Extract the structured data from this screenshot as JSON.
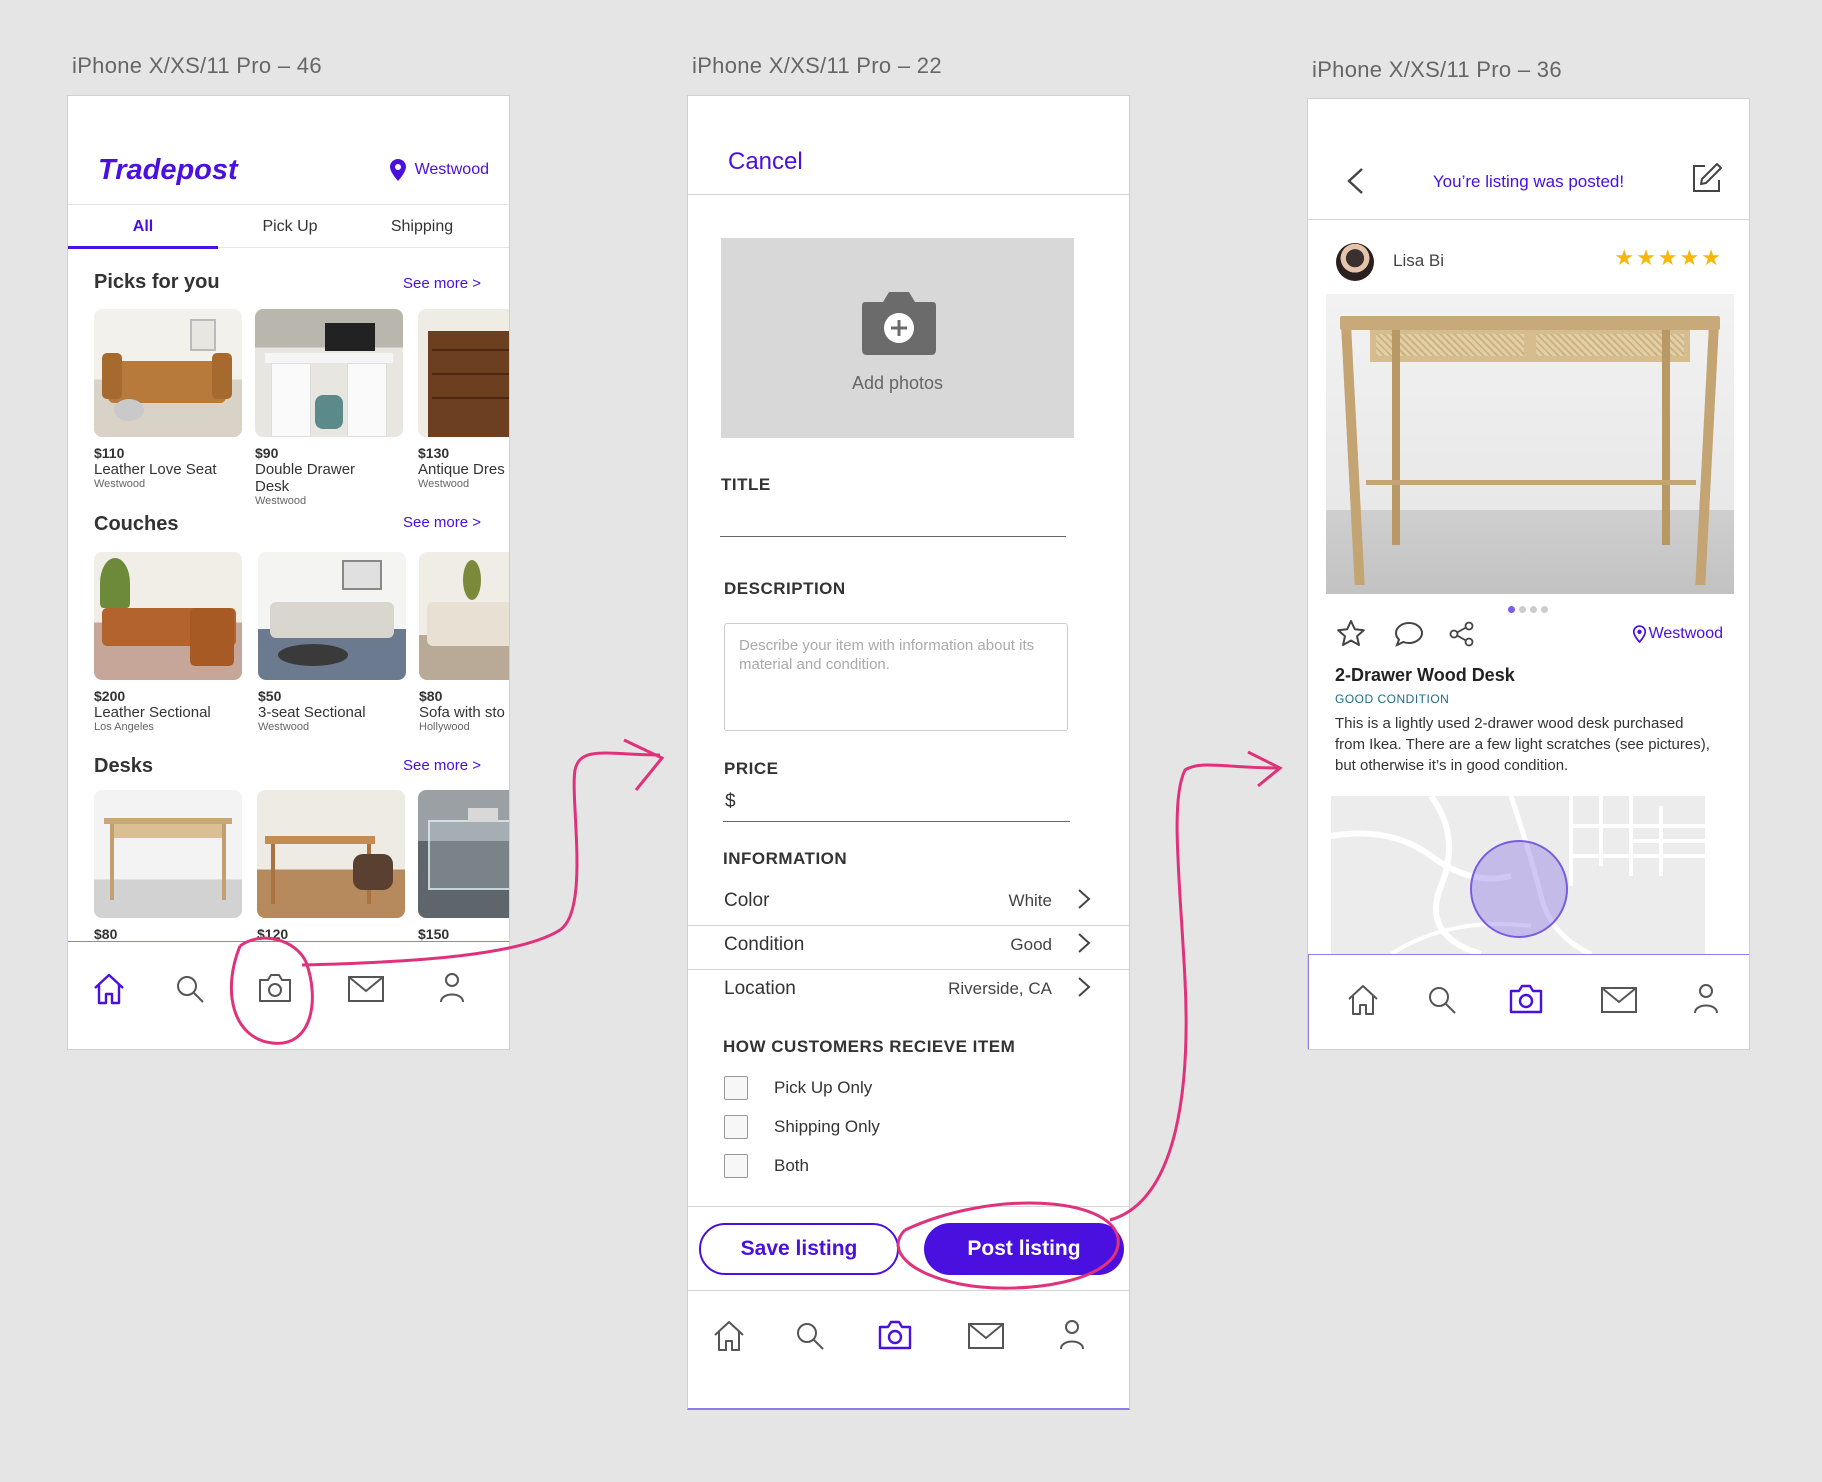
{
  "artboards": {
    "a46": "iPhone X/XS/11 Pro – 46",
    "a22": "iPhone X/XS/11 Pro – 22",
    "a36": "iPhone X/XS/11 Pro – 36"
  },
  "colors": {
    "accent": "#4a10e0",
    "annotation": "#e0327a",
    "star": "#f5b80a"
  },
  "home": {
    "brand": "Tradepost",
    "location": "Westwood",
    "tabs": [
      "All",
      "Pick Up",
      "Shipping"
    ],
    "sections": [
      {
        "title": "Picks for you",
        "see_more": "See more >",
        "items": [
          {
            "price": "$110",
            "name": "Leather Love Seat",
            "loc": "Westwood"
          },
          {
            "price": "$90",
            "name": "Double Drawer",
            "name2": "Desk",
            "loc": "Westwood"
          },
          {
            "price": "$130",
            "name": "Antique Dres",
            "loc": "Westwood"
          }
        ]
      },
      {
        "title": "Couches",
        "see_more": "See more >",
        "items": [
          {
            "price": "$200",
            "name": "Leather Sectional",
            "loc": "Los Angeles"
          },
          {
            "price": "$50",
            "name": "3-seat Sectional",
            "loc": "Westwood"
          },
          {
            "price": "$80",
            "name": "Sofa with sto",
            "loc": "Hollywood"
          }
        ]
      },
      {
        "title": "Desks",
        "see_more": "See more >",
        "items": [
          {
            "price": "$80"
          },
          {
            "price": "$120"
          },
          {
            "price": "$150"
          }
        ]
      }
    ]
  },
  "create": {
    "cancel": "Cancel",
    "add_photos": "Add photos",
    "title_label": "TITLE",
    "description_label": "DESCRIPTION",
    "description_placeholder": "Describe your item with information about its material and condition.",
    "price_label": "PRICE",
    "price_symbol": "$",
    "info_label": "INFORMATION",
    "info_rows": [
      {
        "key": "Color",
        "value": "White"
      },
      {
        "key": "Condition",
        "value": "Good"
      },
      {
        "key": "Location",
        "value": "Riverside, CA"
      }
    ],
    "receive_label": "HOW CUSTOMERS RECIEVE ITEM",
    "receive_options": [
      "Pick Up Only",
      "Shipping Only",
      "Both"
    ],
    "save_label": "Save listing",
    "post_label": "Post listing"
  },
  "posted": {
    "message": "You’re listing was posted!",
    "user": "Lisa Bi",
    "stars": "★★★★★",
    "location": "Westwood",
    "item_title": "2-Drawer Wood Desk",
    "condition": "GOOD CONDITION",
    "description": "This is a lightly used 2-drawer wood desk purchased from Ikea. There are a few light scratches (see pictures), but otherwise it’s in good condition."
  },
  "nav_icons": [
    "home-icon",
    "search-icon",
    "camera-icon",
    "mail-icon",
    "profile-icon"
  ]
}
